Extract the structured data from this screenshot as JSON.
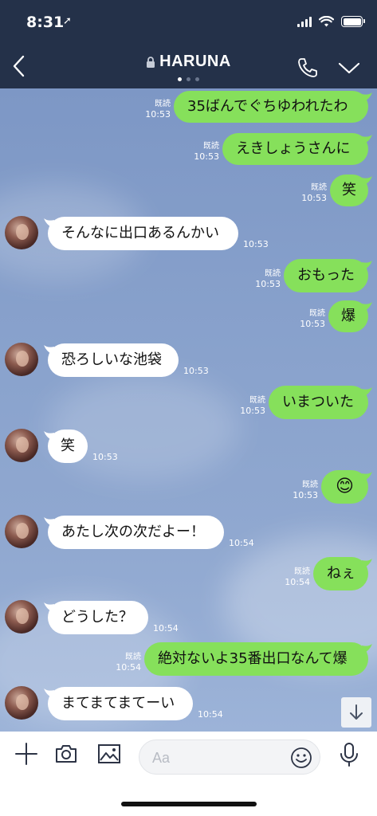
{
  "status_bar": {
    "time": "8:31",
    "location_arrow": "location-arrow-icon"
  },
  "header": {
    "title": "HARUNA",
    "lock_icon": "lock-icon",
    "page_dots": 3,
    "active_dot": 0
  },
  "colors": {
    "header_bg": "#243149",
    "outgoing_bubble": "#86e05b",
    "incoming_bubble": "#ffffff",
    "chat_bg": "#8aa3cd"
  },
  "read_label": "既読",
  "messages": [
    {
      "dir": "out",
      "text": "35ばんでぐちゆわれたわ",
      "time": "10:53",
      "read": true
    },
    {
      "dir": "out",
      "text": "えきしょうさんに",
      "time": "10:53",
      "read": true
    },
    {
      "dir": "out",
      "text": "笑",
      "time": "10:53",
      "read": true
    },
    {
      "dir": "in",
      "text": "そんなに出口あるんかい",
      "time": "10:53"
    },
    {
      "dir": "out",
      "text": "おもった",
      "time": "10:53",
      "read": true
    },
    {
      "dir": "out",
      "text": "爆",
      "time": "10:53",
      "read": true
    },
    {
      "dir": "in",
      "text": "恐ろしいな池袋",
      "time": "10:53"
    },
    {
      "dir": "out",
      "text": "いまついた",
      "time": "10:53",
      "read": true
    },
    {
      "dir": "in",
      "text": "笑",
      "time": "10:53"
    },
    {
      "dir": "out",
      "text": "😊",
      "time": "10:53",
      "read": true
    },
    {
      "dir": "in",
      "text": "あたし次の次だよー！",
      "time": "10:54"
    },
    {
      "dir": "out",
      "text": "ねぇ",
      "time": "10:54",
      "read": true
    },
    {
      "dir": "in",
      "text": "どうした？",
      "time": "10:54"
    },
    {
      "dir": "out",
      "text": "絶対ないよ35番出口なんて爆",
      "time": "10:54",
      "read": true
    },
    {
      "dir": "in",
      "text": "まてまてまてーい",
      "time": "10:54"
    }
  ],
  "input": {
    "placeholder": "Aa",
    "value": ""
  },
  "toolbar_icons": [
    "plus-icon",
    "camera-icon",
    "image-icon",
    "emoji-icon",
    "microphone-icon"
  ]
}
